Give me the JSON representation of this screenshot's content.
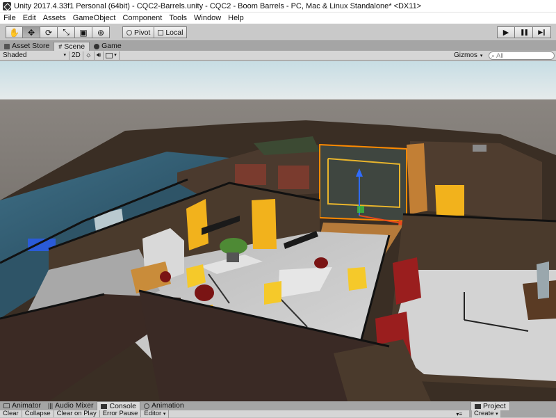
{
  "window": {
    "title": "Unity 2017.4.33f1 Personal (64bit) - CQC2-Barrels.unity - CQC2 - Boom Barrels - PC, Mac & Linux Standalone* <DX11>"
  },
  "menu": [
    "File",
    "Edit",
    "Assets",
    "GameObject",
    "Component",
    "Tools",
    "Window",
    "Help"
  ],
  "toolbar": {
    "tools": [
      {
        "icon": "hand-tool-icon",
        "glyph": "✋"
      },
      {
        "icon": "move-tool-icon",
        "glyph": "✥"
      },
      {
        "icon": "rotate-tool-icon",
        "glyph": "⟳"
      },
      {
        "icon": "scale-tool-icon",
        "glyph": "⤡"
      },
      {
        "icon": "rect-tool-icon",
        "glyph": "▣"
      },
      {
        "icon": "transform-tool-icon",
        "glyph": "⊕"
      }
    ],
    "pivot_label": "Pivot",
    "local_label": "Local",
    "play_glyph": "▶",
    "pause_glyph": "❚❚",
    "step_glyph": "▶❙"
  },
  "tabs": {
    "asset_store": "Asset Store",
    "scene": "Scene",
    "game": "Game"
  },
  "scene_bar": {
    "shading": "Shaded",
    "mode_2d": "2D",
    "gizmos": "Gizmos",
    "search_placeholder": "All"
  },
  "bottom": {
    "tabs": [
      "Animator",
      "Audio Mixer",
      "Console",
      "Animation"
    ],
    "active_tab": "Console",
    "console_buttons": [
      "Clear",
      "Collapse",
      "Clear on Play",
      "Error Pause",
      "Editor"
    ],
    "project_label": "Project",
    "create_label": "Create"
  },
  "colors": {
    "door_yellow": "#f2b21c",
    "selection_orange": "#ff8a00",
    "wall_brown": "#4a3a2c",
    "floor_grey": "#bdbdbd",
    "sky": "#bcd4dc"
  }
}
